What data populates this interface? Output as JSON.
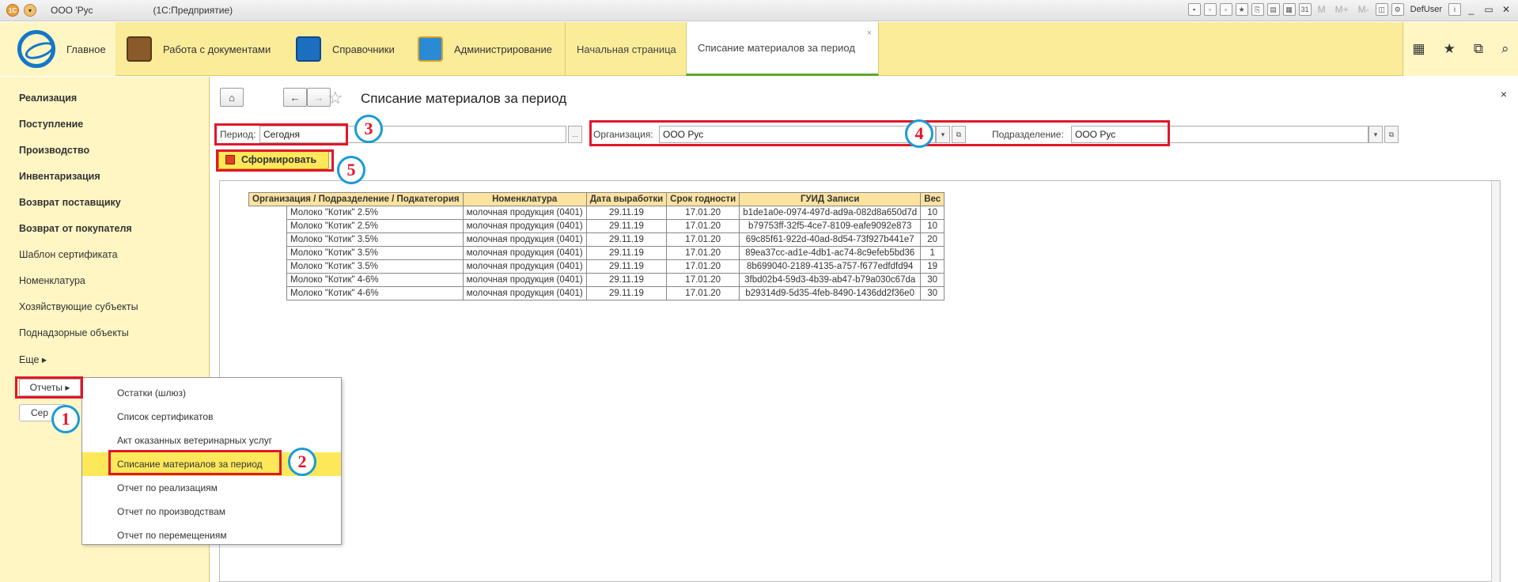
{
  "titlebar": {
    "org": "ООО 'Рус",
    "app": "(1С:Предприятие)",
    "m_labels": [
      "M",
      "M+",
      "M-"
    ],
    "user": "DefUser",
    "win_controls": [
      "_",
      "▭",
      "✕"
    ]
  },
  "sections": {
    "main": "Главное",
    "docs": "Работа с документами",
    "refs": "Справочники",
    "admin": "Администрирование",
    "colors": {
      "docs": "#8b5a2b",
      "refs": "#1c6fc0",
      "admin": "#2a8ad6"
    }
  },
  "tabs": {
    "home": "Начальная страница",
    "active": "Списание материалов за период",
    "close": "×"
  },
  "tools": [
    "▦",
    "★",
    "⧉",
    "⌕"
  ],
  "leftnav": {
    "items": [
      {
        "label": "Реализация",
        "bold": true
      },
      {
        "label": "Поступление",
        "bold": true
      },
      {
        "label": "Производство",
        "bold": true
      },
      {
        "label": "Инвентаризация",
        "bold": true
      },
      {
        "label": "Возврат поставщику",
        "bold": true
      },
      {
        "label": "Возврат от покупателя",
        "bold": true
      },
      {
        "label": "Шаблон сертификата",
        "bold": false
      },
      {
        "label": "Номенклатура",
        "bold": false
      },
      {
        "label": "Хозяйствующие субъекты",
        "bold": false
      },
      {
        "label": "Поднадзорные объекты",
        "bold": false
      },
      {
        "label": "Еще ▸",
        "bold": false
      }
    ],
    "reports": "Отчеты ▸",
    "cert_btn": "Сер"
  },
  "work": {
    "title": "Списание материалов за период",
    "close": "×",
    "period_label": "Период:",
    "period_value": "Сегодня",
    "period_btn": "...",
    "org_label": "Организация:",
    "org_value": "ООО  Рус",
    "subdiv_label": "Подразделение:",
    "subdiv_value": "ООО Рус",
    "form_btn": "Сформировать"
  },
  "report": {
    "headers": [
      "Организация / Подразделение / Подкатегория",
      "Номенклатура",
      "Дата выработки",
      "Срок годности",
      "ГУИД Записи",
      "Вес"
    ],
    "rows": [
      [
        "Молоко \"Котик\" 2.5%",
        "молочная продукция (0401)",
        "29.11.19",
        "17.01.20",
        "b1de1a0e-0974-497d-ad9a-082d8a650d7d",
        "10"
      ],
      [
        "Молоко \"Котик\" 2.5%",
        "молочная продукция (0401)",
        "29.11.19",
        "17.01.20",
        "b79753ff-32f5-4ce7-8109-eafe9092e873",
        "10"
      ],
      [
        "Молоко \"Котик\" 3.5%",
        "молочная продукция (0401)",
        "29.11.19",
        "17.01.20",
        "69c85f61-922d-40ad-8d54-73f927b441e7",
        "20"
      ],
      [
        "Молоко \"Котик\" 3.5%",
        "молочная продукция (0401)",
        "29.11.19",
        "17.01.20",
        "89ea37cc-ad1e-4db1-ac74-8c9efeb5bd36",
        "1"
      ],
      [
        "Молоко \"Котик\" 3.5%",
        "молочная продукция (0401)",
        "29.11.19",
        "17.01.20",
        "8b699040-2189-4135-a757-f677edfdfd94",
        "19"
      ],
      [
        "Молоко \"Котик\" 4-6%",
        "молочная продукция (0401)",
        "29.11.19",
        "17.01.20",
        "3fbd02b4-59d3-4b39-ab47-b79a030c67da",
        "30"
      ],
      [
        "Молоко \"Котик\" 4-6%",
        "молочная продукция (0401)",
        "29.11.19",
        "17.01.20",
        "b29314d9-5d35-4feb-8490-1436dd2f36e0",
        "30"
      ]
    ]
  },
  "dropdown": [
    "Остатки (шлюз)",
    "Список сертификатов",
    "Акт оказанных ветеринарных услуг",
    "Списание материалов за период",
    "Отчет по реализациям",
    "Отчет по производствам",
    "Отчет по перемещениям"
  ],
  "annotations": [
    "1",
    "2",
    "3",
    "4",
    "5"
  ],
  "colors": {
    "annotation_red": "#e2162a",
    "annotation_blue": "#1a9ad8",
    "section_bg": "#fbec9a",
    "active_tab_underline": "#5ea52e"
  }
}
